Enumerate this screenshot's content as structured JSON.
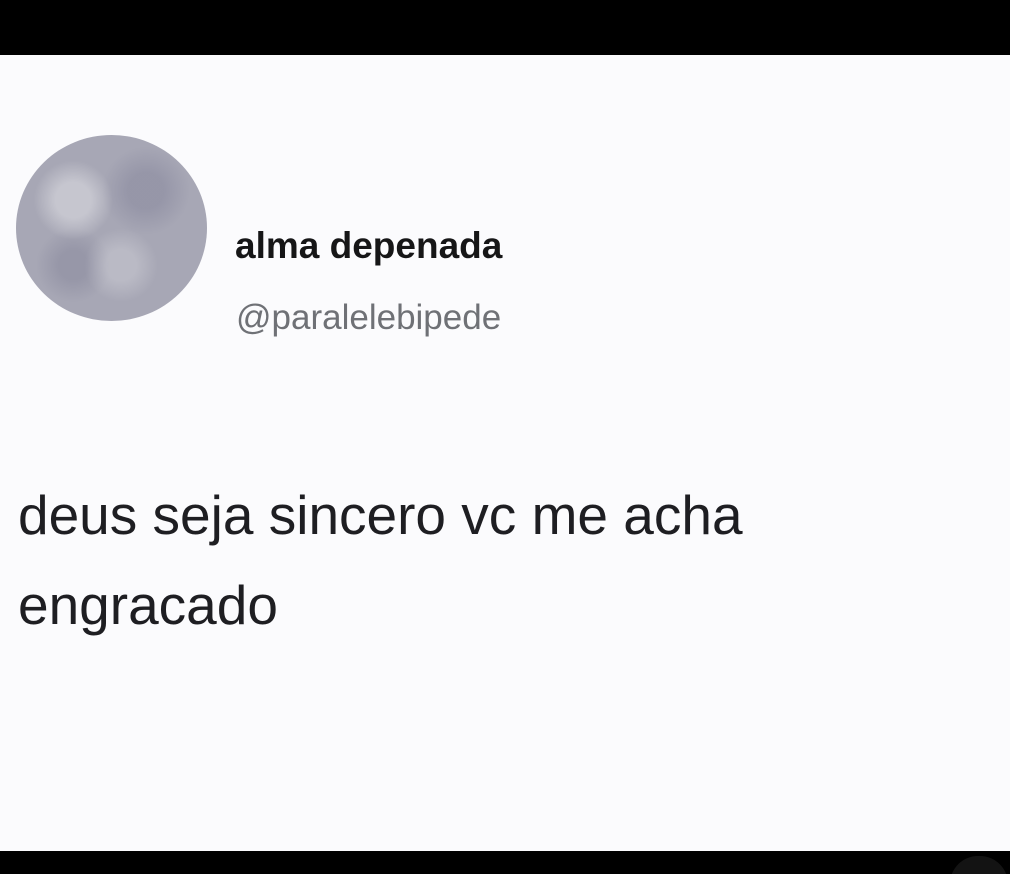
{
  "tweet": {
    "author": {
      "display_name": "alma depenada",
      "handle": "@paralelebipede",
      "avatar_icon": "blurred-profile-avatar"
    },
    "text": "deus seja sincero vc me acha\nengracado"
  },
  "colors": {
    "background": "#fbfbfd",
    "frame": "#000000",
    "text_primary": "#161617",
    "text_secondary": "#6f7176"
  }
}
